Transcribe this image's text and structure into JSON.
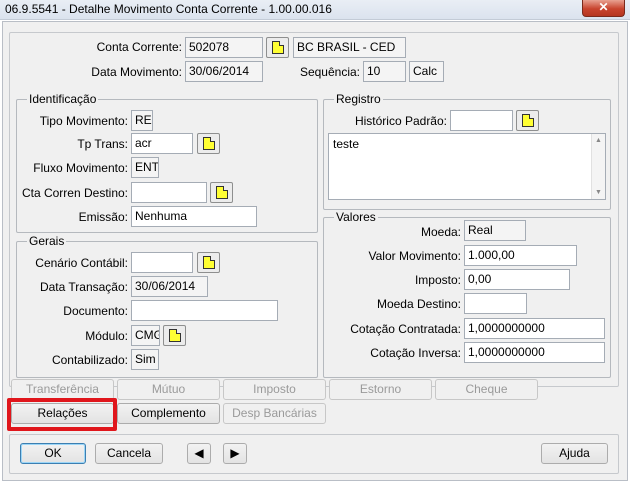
{
  "window": {
    "title": "06.9.5541 - Detalhe Movimento Conta Corrente - 1.00.00.016",
    "close_label": "✕"
  },
  "header": {
    "conta_corrente_label": "Conta Corrente:",
    "conta_corrente_value": "502078",
    "conta_corrente_desc": "BC BRASIL - CED",
    "data_movimento_label": "Data Movimento:",
    "data_movimento_value": "30/06/2014",
    "sequencia_label": "Sequência:",
    "sequencia_value": "10",
    "calc_value": "Calc"
  },
  "identificacao": {
    "legend": "Identificação",
    "tipo_movimento_label": "Tipo Movimento:",
    "tipo_movimento_value": "RE",
    "tp_trans_label": "Tp Trans:",
    "tp_trans_value": "acr",
    "fluxo_movimento_label": "Fluxo Movimento:",
    "fluxo_movimento_value": "ENT",
    "cta_corren_destino_label": "Cta Corren Destino:",
    "cta_corren_destino_value": "",
    "emissao_label": "Emissão:",
    "emissao_value": "Nenhuma"
  },
  "gerais": {
    "legend": "Gerais",
    "cenario_label": "Cenário Contábil:",
    "cenario_value": "",
    "data_transacao_label": "Data Transação:",
    "data_transacao_value": "30/06/2014",
    "documento_label": "Documento:",
    "documento_value": "",
    "modulo_label": "Módulo:",
    "modulo_value": "CMG",
    "contabilizado_label": "Contabilizado:",
    "contabilizado_value": "Sim"
  },
  "registro": {
    "legend": "Registro",
    "historico_label": "Histórico Padrão:",
    "historico_value": "",
    "text_value": "teste"
  },
  "valores": {
    "legend": "Valores",
    "moeda_label": "Moeda:",
    "moeda_value": "Real",
    "valor_movimento_label": "Valor Movimento:",
    "valor_movimento_value": "1.000,00",
    "imposto_label": "Imposto:",
    "imposto_value": "0,00",
    "moeda_destino_label": "Moeda Destino:",
    "moeda_destino_value": "",
    "cotacao_contratada_label": "Cotação Contratada:",
    "cotacao_contratada_value": "1,0000000000",
    "cotacao_inversa_label": "Cotação Inversa:",
    "cotacao_inversa_value": "1,0000000000"
  },
  "action_buttons": {
    "transferencia": "Transferência",
    "mutuo": "Mútuo",
    "imposto": "Imposto",
    "estorno": "Estorno",
    "cheque": "Cheque",
    "relacoes": "Relações",
    "complemento": "Complemento",
    "desp_bancarias": "Desp Bancárias"
  },
  "footer": {
    "ok": "OK",
    "cancela": "Cancela",
    "prev": "◀",
    "next": "▶",
    "ajuda": "Ajuda"
  },
  "colors": {
    "highlight": "#e0161c",
    "lookup_note": "#ffff33"
  }
}
